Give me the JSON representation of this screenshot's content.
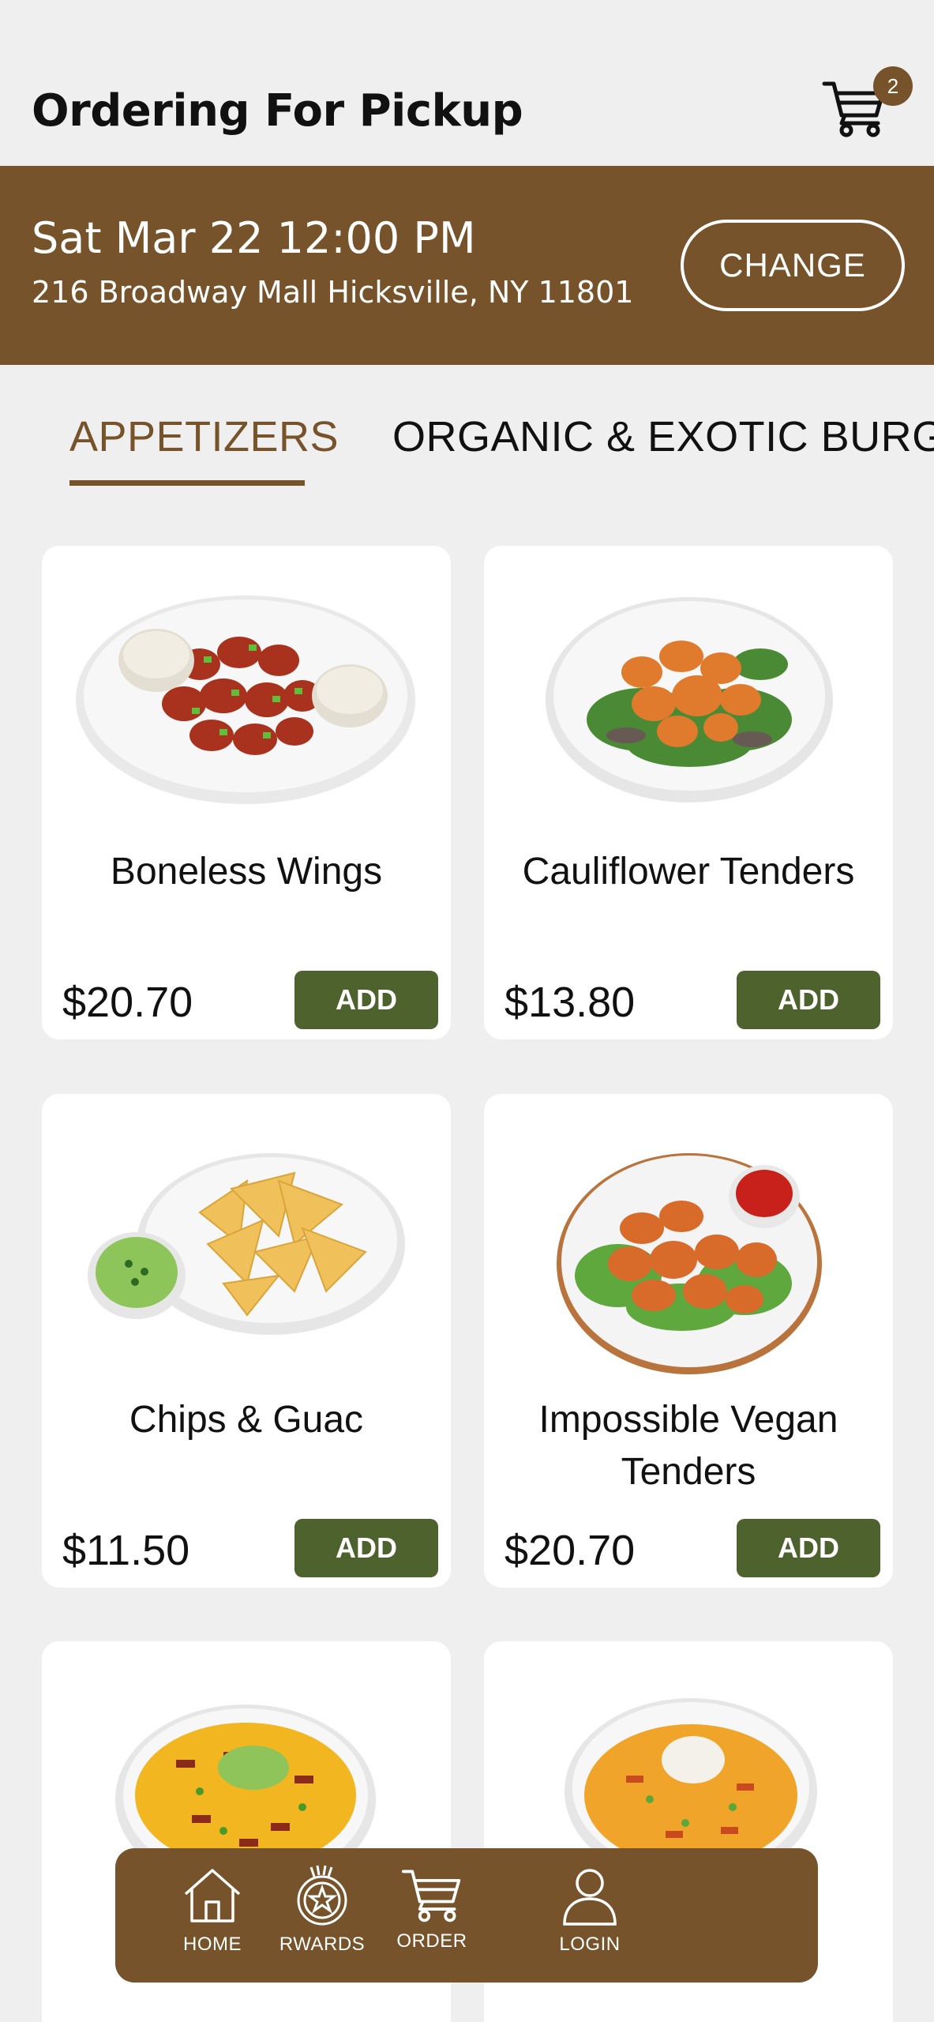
{
  "header": {
    "title": "Ordering For Pickup",
    "cart_count": "2"
  },
  "pickup": {
    "datetime": "Sat Mar 22 12:00 PM",
    "address": "216 Broadway Mall Hicksville, NY 11801",
    "change_label": "CHANGE"
  },
  "tabs": [
    {
      "label": "APPETIZERS",
      "active": true
    },
    {
      "label": "ORGANIC & EXOTIC BURGE",
      "active": false
    }
  ],
  "products": [
    {
      "name": "Boneless Wings",
      "price": "$20.70",
      "add_label": "ADD"
    },
    {
      "name": "Cauliflower Tenders",
      "price": "$13.80",
      "add_label": "ADD"
    },
    {
      "name": "Chips & Guac",
      "price": "$11.50",
      "add_label": "ADD"
    },
    {
      "name": "Impossible Vegan Tenders",
      "price": "$20.70",
      "add_label": "ADD"
    }
  ],
  "nav": {
    "home": "HOME",
    "rewards": "RWARDS",
    "order": "ORDER",
    "login": "LOGIN"
  },
  "colors": {
    "brand_brown": "#76532a",
    "add_green": "#4e622d",
    "background": "#efeff0"
  }
}
